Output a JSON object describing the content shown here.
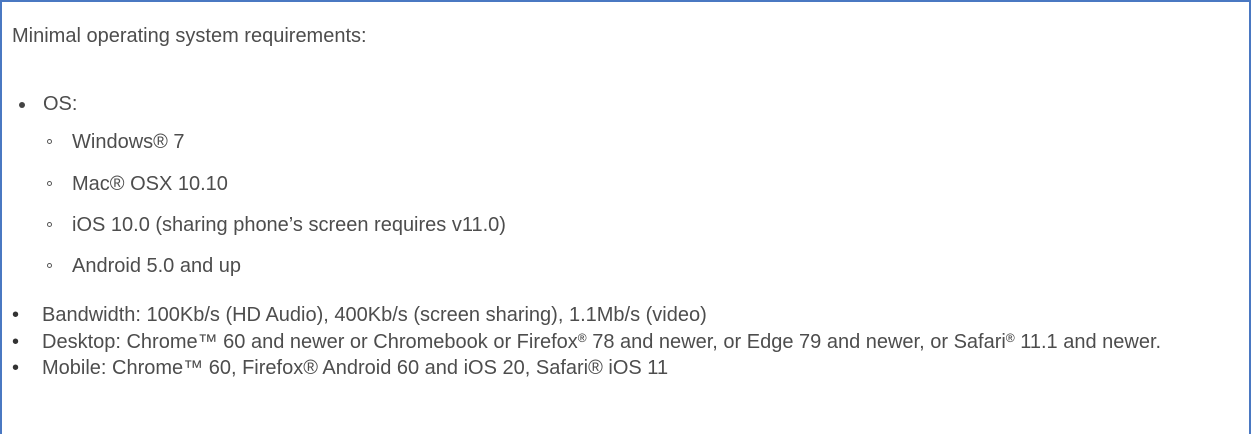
{
  "intro": "Minimal operating system requirements:",
  "os": {
    "label": "OS:",
    "items": [
      "Windows® 7",
      "Mac® OSX 10.10",
      "iOS 10.0 (sharing phone’s screen requires v11.0)",
      "Android 5.0 and up"
    ]
  },
  "requirements": {
    "bandwidth": "Bandwidth: 100Kb/s (HD Audio), 400Kb/s (screen sharing), 1.1Mb/s (video)",
    "desktop": {
      "part1": "Desktop: Chrome™ 60 and newer or Chromebook or Firefox",
      "sup1": "®",
      "part2": " 78 and newer, or Edge 79 and newer, or Safari",
      "sup2": "®",
      "part3": " 11.1 and newer."
    },
    "mobile": "Mobile: Chrome™ 60, Firefox® Android 60 and iOS 20, Safari® iOS 11"
  },
  "colors": {
    "border": "#4a78c2",
    "text": "#4d4d4d"
  }
}
